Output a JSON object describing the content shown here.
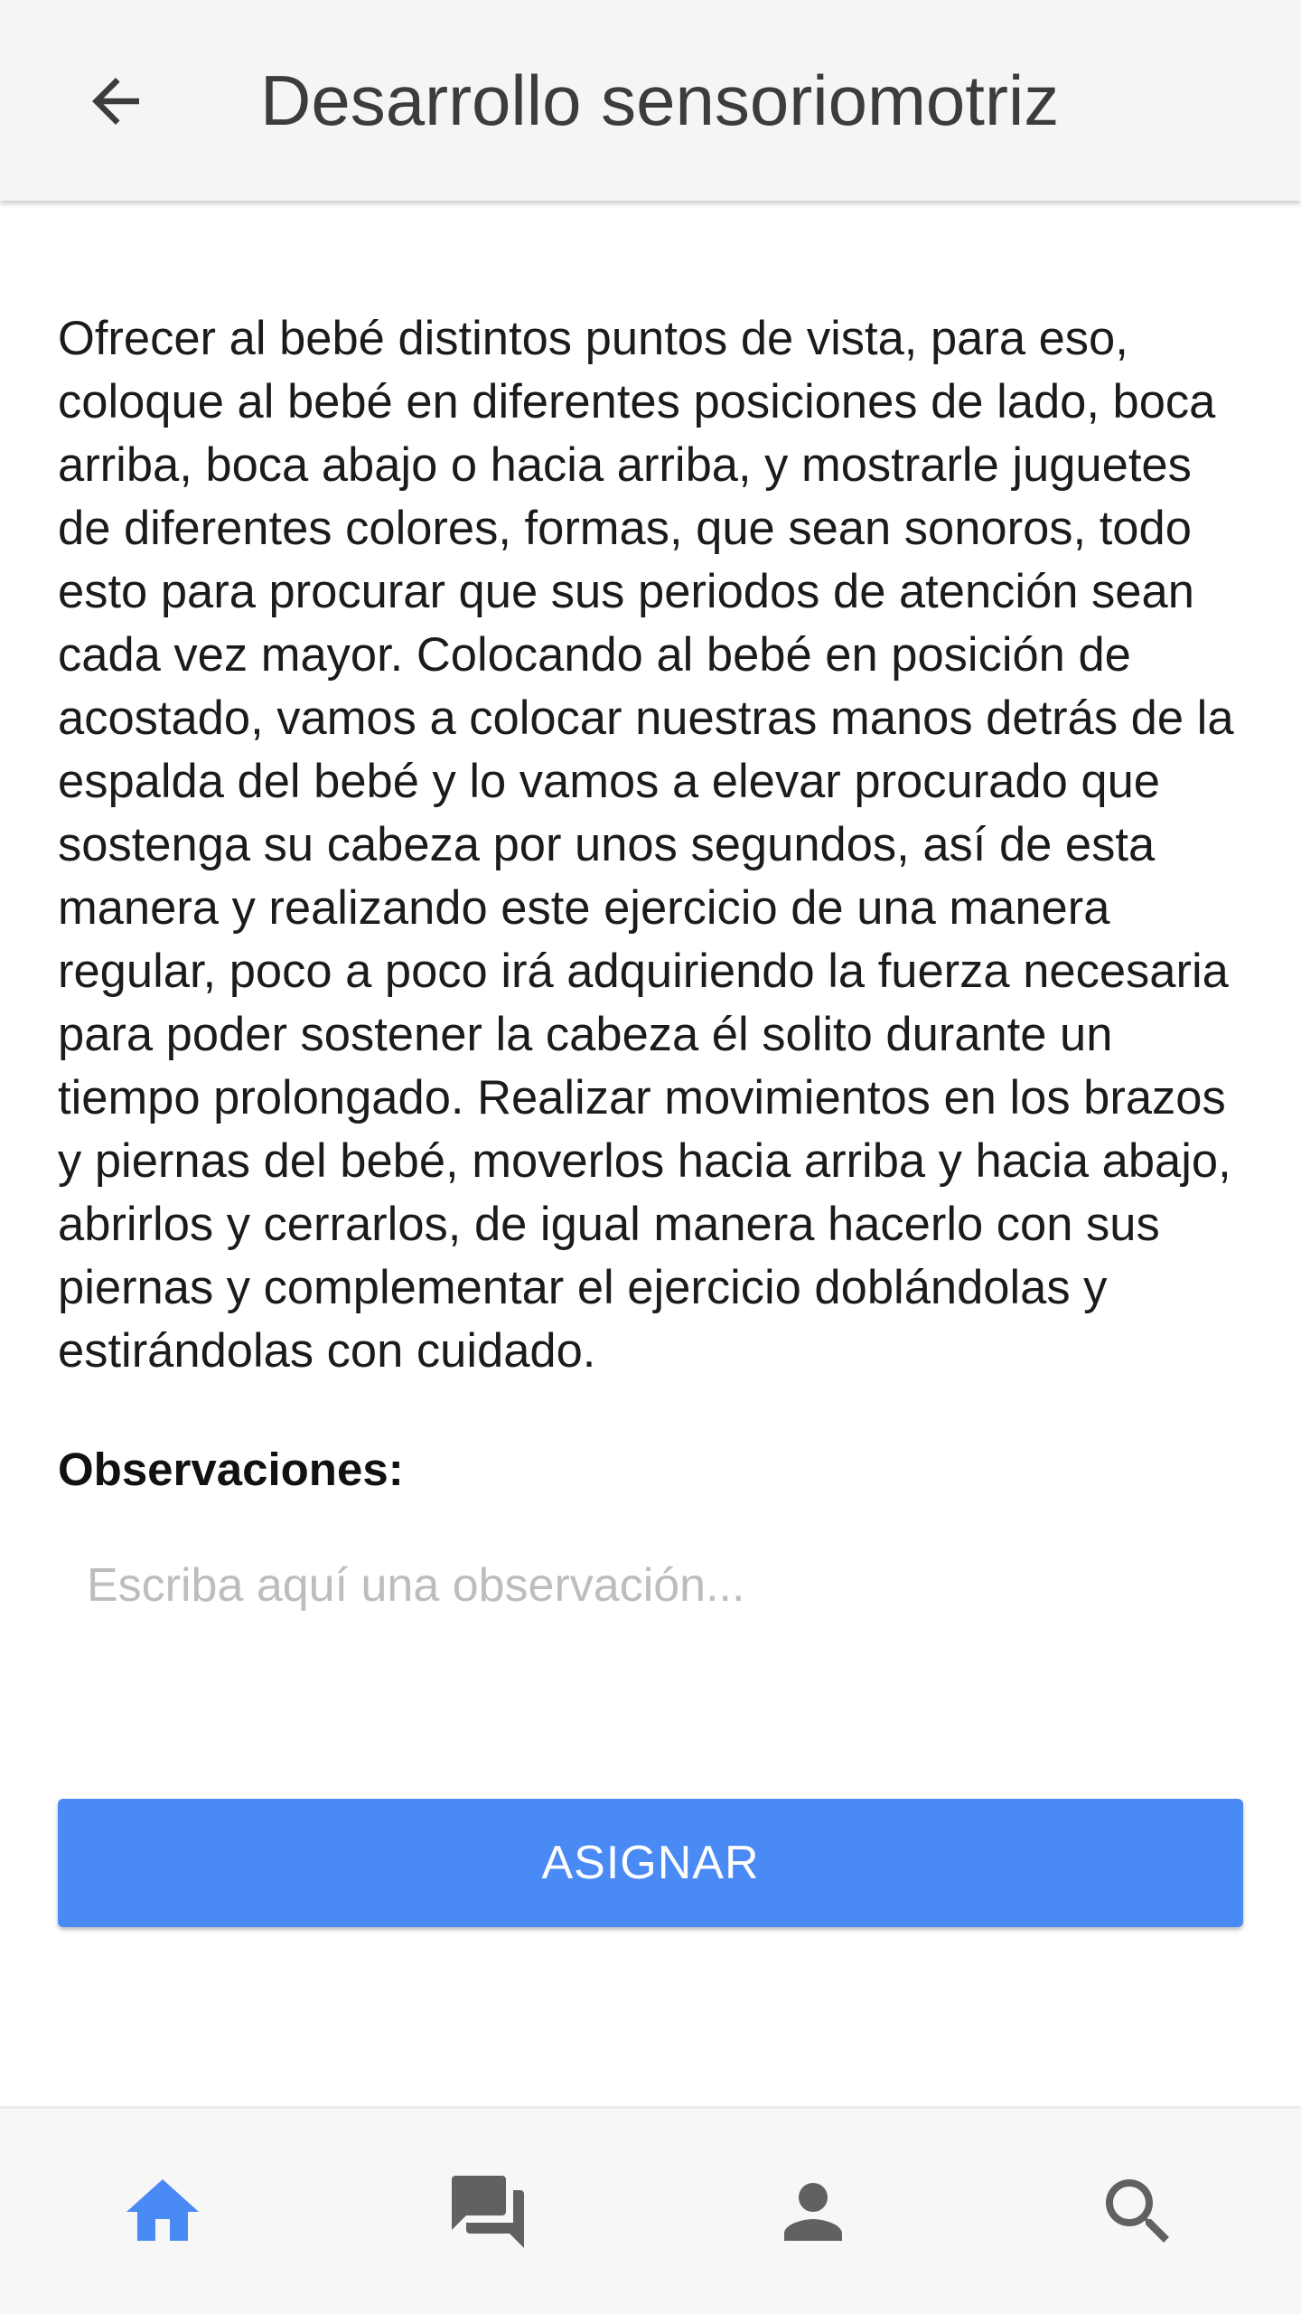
{
  "header": {
    "title": "Desarrollo sensoriomotriz",
    "back_icon": "arrow-back-icon"
  },
  "content": {
    "description": "Ofrecer al bebé distintos puntos de vista, para eso, coloque al bebé en diferentes posiciones de lado, boca arriba, boca abajo o hacia arriba, y mostrarle juguetes de diferentes colores, formas, que sean sonoros, todo esto para procurar que sus periodos de atención sean cada vez mayor. Colocando al bebé en posición de acostado, vamos a colocar nuestras manos detrás de la espalda del bebé y lo vamos a elevar procurado que sostenga su cabeza por unos segundos, así de esta manera y realizando este ejercicio de una manera regular, poco a poco irá adquiriendo la fuerza necesaria para poder sostener la cabeza él solito durante un tiempo prolongado. Realizar movimientos en los brazos y piernas del bebé, moverlos hacia arriba y hacia abajo, abrirlos y cerrarlos, de igual manera hacerlo con sus piernas y complementar el ejercicio doblándolas y estirándolas con cuidado.",
    "observations_label": "Observaciones:",
    "observations_placeholder": "Escriba aquí una observación...",
    "observations_value": ""
  },
  "actions": {
    "assign_label": "ASIGNAR"
  },
  "bottom_nav": {
    "items": [
      {
        "icon": "home-icon",
        "active": true
      },
      {
        "icon": "chat-icon",
        "active": false
      },
      {
        "icon": "person-icon",
        "active": false
      },
      {
        "icon": "search-icon",
        "active": false
      }
    ]
  },
  "colors": {
    "accent": "#4a8af4",
    "icon_inactive": "#616161",
    "appbar_bg": "#f5f5f5",
    "nav_bg": "#f7f7f7"
  }
}
